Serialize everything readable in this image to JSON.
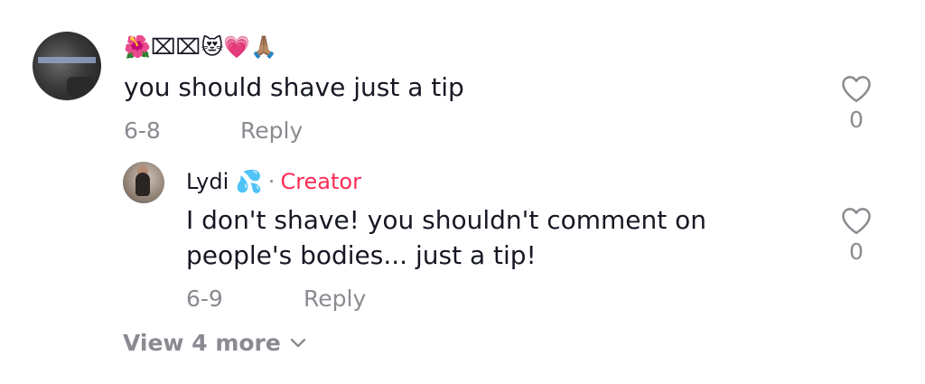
{
  "comment": {
    "username": "🌺⌧⌧😻💗🙏🏽",
    "text": "you should shave just a tip",
    "date": "6-8",
    "reply_label": "Reply",
    "like_count": "0"
  },
  "reply": {
    "author": "Lydi 💦",
    "separator": "·",
    "badge": "Creator",
    "text": "I don't shave! you shouldn't comment on people's bodies... just a tip!",
    "date": "6-9",
    "reply_label": "Reply",
    "like_count": "0"
  },
  "view_more": {
    "label": "View 4 more"
  },
  "colors": {
    "accent": "#fe2c55",
    "muted": "#8a8b91",
    "text": "#161823"
  },
  "icons": {
    "like": "heart-outline-icon",
    "expand": "chevron-down-icon"
  }
}
